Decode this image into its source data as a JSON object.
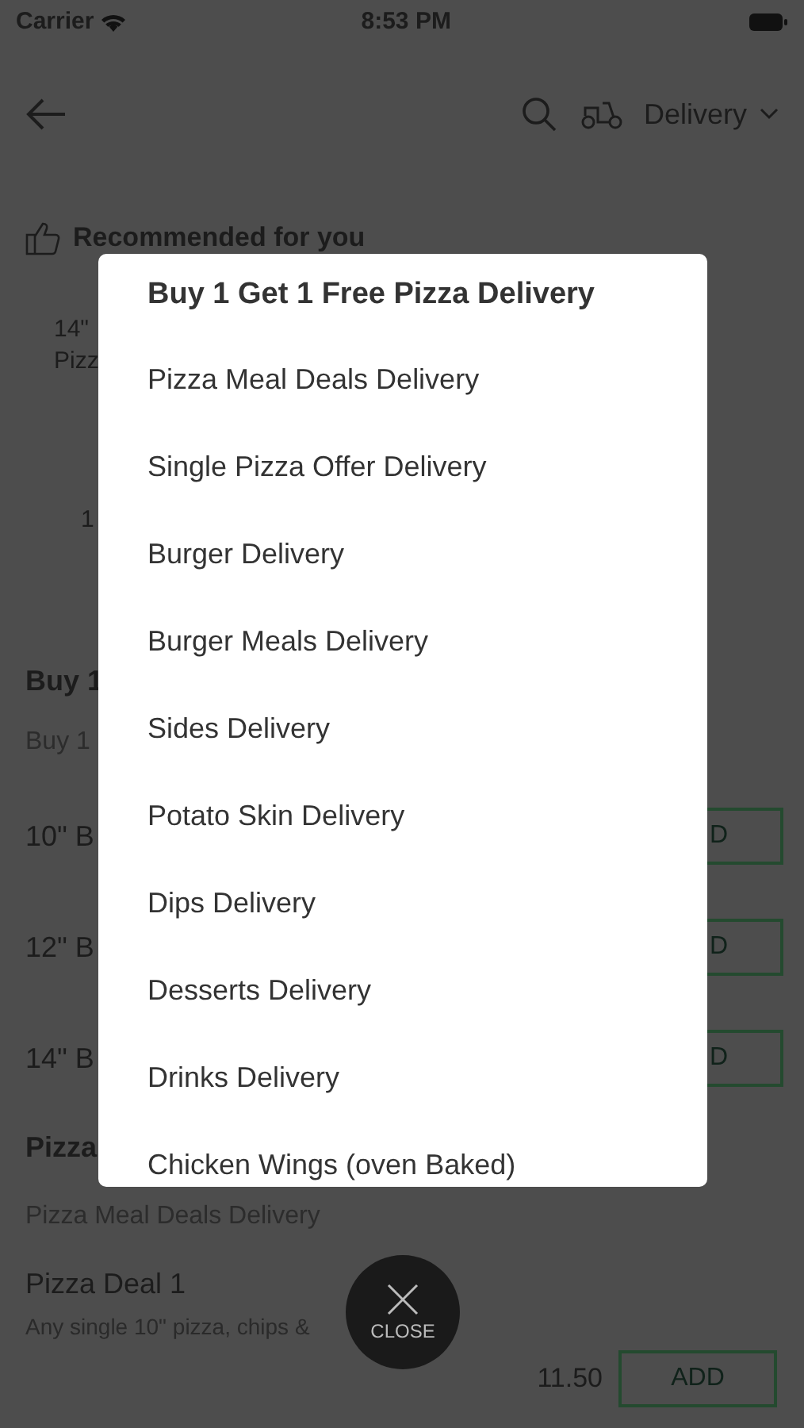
{
  "status_bar": {
    "carrier": "Carrier",
    "time": "8:53 PM"
  },
  "header": {
    "delivery_mode": "Delivery"
  },
  "recommended": {
    "title": "Recommended for you",
    "card_texts": [
      "14\"",
      "Pizz"
    ],
    "second_card_text": "1"
  },
  "sections": [
    {
      "title": "Buy 1",
      "subtitle": "Buy 1",
      "items": [
        {
          "name": "10\" B",
          "add_label": "D"
        },
        {
          "name": "12\" B",
          "add_label": "D"
        },
        {
          "name": "14\" B",
          "add_label": "D"
        }
      ]
    },
    {
      "title": "Pizza",
      "subtitle": "Pizza Meal Deals Delivery",
      "items": [
        {
          "name": "Pizza Deal 1",
          "description": "Any single 10\" pizza, chips &",
          "price": "11.50",
          "add_label": "ADD"
        }
      ]
    }
  ],
  "modal": {
    "title": "Buy 1 Get 1 Free Pizza Delivery",
    "items": [
      "Pizza Meal Deals Delivery",
      "Single Pizza Offer Delivery",
      "Burger Delivery",
      "Burger Meals Delivery",
      "Sides Delivery",
      "Potato Skin Delivery",
      "Dips Delivery",
      "Desserts Delivery",
      "Drinks Delivery",
      "Chicken Wings (oven Baked)"
    ]
  },
  "close_button": {
    "label": "CLOSE"
  }
}
